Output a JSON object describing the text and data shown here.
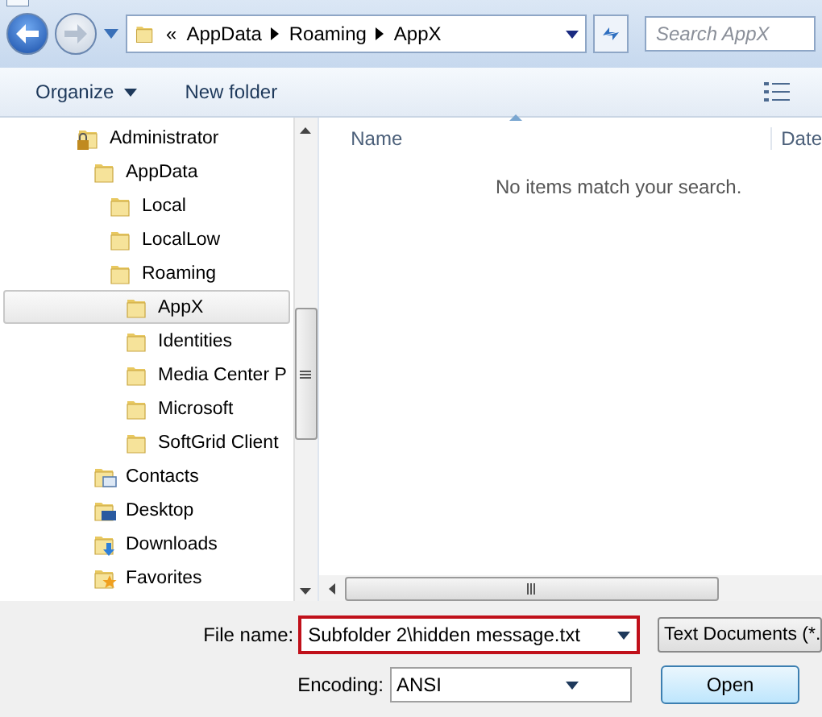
{
  "nav": {
    "back_enabled": true,
    "forward_enabled": false
  },
  "address": {
    "overflow": "«",
    "crumbs": [
      "AppData",
      "Roaming",
      "AppX"
    ]
  },
  "search": {
    "placeholder": "Search AppX"
  },
  "toolbar": {
    "organize": "Organize",
    "new_folder": "New folder"
  },
  "tree": [
    {
      "label": "Administrator",
      "kind": "locked",
      "selected": false,
      "children": [
        {
          "label": "AppData",
          "kind": "folder",
          "selected": false,
          "children": [
            {
              "label": "Local",
              "kind": "folder",
              "selected": false
            },
            {
              "label": "LocalLow",
              "kind": "folder",
              "selected": false
            },
            {
              "label": "Roaming",
              "kind": "folder",
              "selected": false,
              "children": [
                {
                  "label": "AppX",
                  "kind": "folder",
                  "selected": true
                },
                {
                  "label": "Identities",
                  "kind": "folder",
                  "selected": false
                },
                {
                  "label": "Media Center P",
                  "kind": "folder",
                  "selected": false
                },
                {
                  "label": "Microsoft",
                  "kind": "folder",
                  "selected": false
                },
                {
                  "label": "SoftGrid Client",
                  "kind": "folder",
                  "selected": false
                }
              ]
            }
          ]
        },
        {
          "label": "Contacts",
          "kind": "contacts",
          "selected": false
        },
        {
          "label": "Desktop",
          "kind": "desktop",
          "selected": false
        },
        {
          "label": "Downloads",
          "kind": "downloads",
          "selected": false
        },
        {
          "label": "Favorites",
          "kind": "favorites",
          "selected": false
        }
      ]
    }
  ],
  "list": {
    "columns": [
      "Name",
      "Date"
    ],
    "empty_message": "No items match your search."
  },
  "file_name": {
    "label": "File name:",
    "value": "Subfolder 2\\hidden message.txt",
    "highlighted": true
  },
  "file_type": {
    "value": "Text Documents (*."
  },
  "encoding": {
    "label": "Encoding:",
    "value": "ANSI"
  },
  "buttons": [
    "Open"
  ]
}
